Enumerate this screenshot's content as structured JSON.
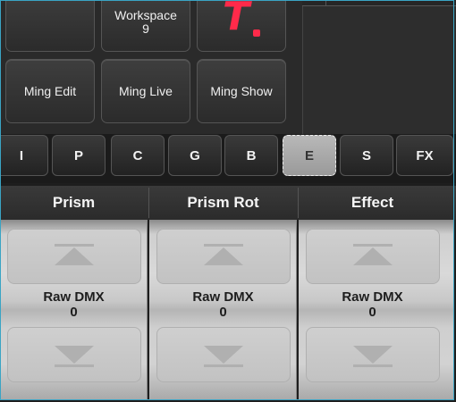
{
  "workspaces": [
    {
      "name": "Workspace",
      "number": "9"
    },
    {
      "name": "Ming Edit"
    },
    {
      "name": "Ming Live"
    },
    {
      "name": "Ming Show"
    }
  ],
  "logo": {
    "letter": "T"
  },
  "tabs": [
    "I",
    "P",
    "C",
    "G",
    "B",
    "E",
    "S",
    "FX"
  ],
  "active_tab": "E",
  "columns": [
    {
      "header": "Prism",
      "mode": "Raw DMX",
      "value": "0"
    },
    {
      "header": "Prism Rot",
      "mode": "Raw DMX",
      "value": "0"
    },
    {
      "header": "Effect",
      "mode": "Raw DMX",
      "value": "0"
    }
  ],
  "colors": {
    "accent": "#ff2a4a",
    "active_tab": "#a8a8a8",
    "frame": "#3aa4c4"
  }
}
